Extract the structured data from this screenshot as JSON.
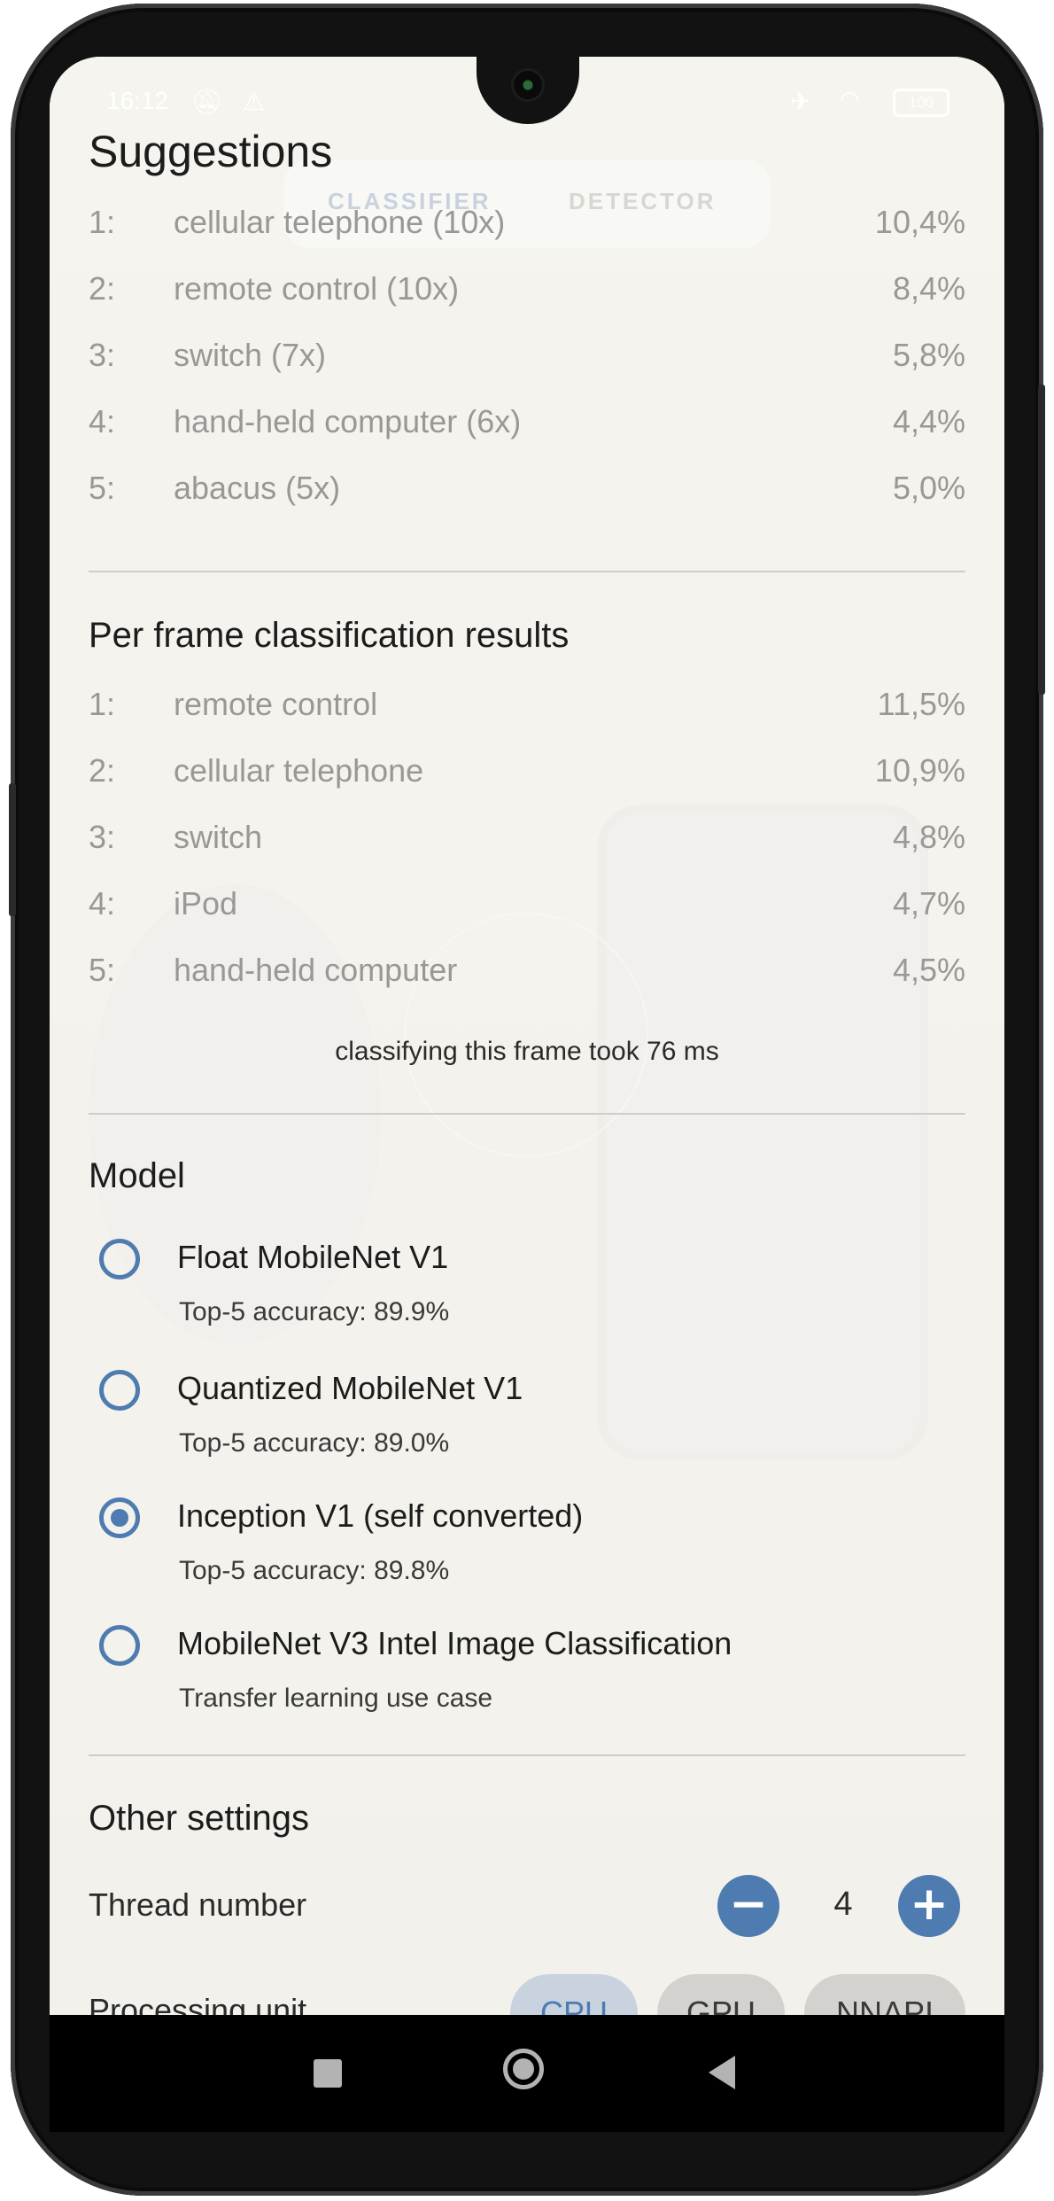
{
  "status_bar": {
    "time": "16:12",
    "battery": "100"
  },
  "mode_tabs": {
    "classifier": "CLASSIFIER",
    "detector": "DETECTOR"
  },
  "suggestions": {
    "title": "Suggestions",
    "rows": [
      {
        "idx": "1:",
        "label": "cellular telephone (10x)",
        "pct": "10,4%"
      },
      {
        "idx": "2:",
        "label": "remote control (10x)",
        "pct": "8,4%"
      },
      {
        "idx": "3:",
        "label": "switch (7x)",
        "pct": "5,8%"
      },
      {
        "idx": "4:",
        "label": "hand-held computer (6x)",
        "pct": "4,4%"
      },
      {
        "idx": "5:",
        "label": "abacus (5x)",
        "pct": "5,0%"
      }
    ]
  },
  "per_frame": {
    "title": "Per frame classification results",
    "rows": [
      {
        "idx": "1:",
        "label": "remote control",
        "pct": "11,5%"
      },
      {
        "idx": "2:",
        "label": "cellular telephone",
        "pct": "10,9%"
      },
      {
        "idx": "3:",
        "label": "switch",
        "pct": "4,8%"
      },
      {
        "idx": "4:",
        "label": "iPod",
        "pct": "4,7%"
      },
      {
        "idx": "5:",
        "label": "hand-held computer",
        "pct": "4,5%"
      }
    ],
    "timing": "classifying this frame took 76 ms"
  },
  "model": {
    "title": "Model",
    "options": [
      {
        "name": "Float MobileNet V1",
        "sub": "Top-5 accuracy: 89.9%",
        "selected": false
      },
      {
        "name": "Quantized MobileNet V1",
        "sub": "Top-5 accuracy: 89.0%",
        "selected": false
      },
      {
        "name": "Inception V1 (self converted)",
        "sub": "Top-5 accuracy: 89.8%",
        "selected": true
      },
      {
        "name": "MobileNet V3 Intel Image Classification",
        "sub": "Transfer learning use case",
        "selected": false
      }
    ]
  },
  "other_settings": {
    "title": "Other settings",
    "thread_label": "Thread number",
    "thread_value": "4",
    "minus": "−",
    "plus": "+",
    "processing_label": "Processing unit",
    "units": [
      {
        "label": "CPU",
        "selected": true
      },
      {
        "label": "GPU",
        "selected": false
      },
      {
        "label": "NNAPI",
        "selected": false
      }
    ]
  },
  "colors": {
    "accent": "#4e7bb0",
    "chip_selected_bg": "#c9d3df",
    "chip_bg": "#d4d2ce"
  }
}
